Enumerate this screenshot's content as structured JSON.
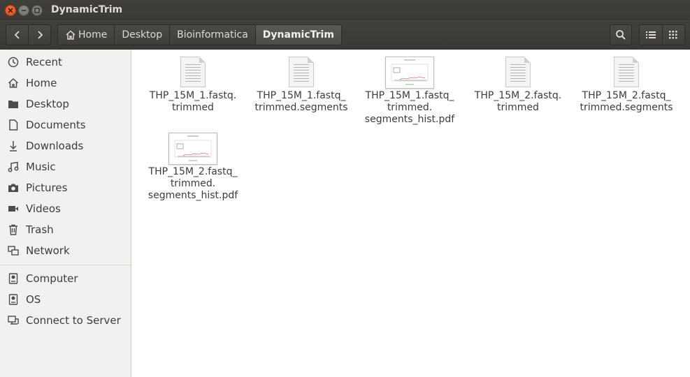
{
  "window": {
    "title": "DynamicTrim"
  },
  "breadcrumb": [
    {
      "label": "Home",
      "icon": "home-icon"
    },
    {
      "label": "Desktop"
    },
    {
      "label": "Bioinformatica"
    },
    {
      "label": "DynamicTrim",
      "active": true
    }
  ],
  "sidebar": {
    "items": [
      {
        "label": "Recent",
        "icon": "clock-icon"
      },
      {
        "label": "Home",
        "icon": "home-icon"
      },
      {
        "label": "Desktop",
        "icon": "folder-icon"
      },
      {
        "label": "Documents",
        "icon": "document-icon"
      },
      {
        "label": "Downloads",
        "icon": "download-icon"
      },
      {
        "label": "Music",
        "icon": "music-icon"
      },
      {
        "label": "Pictures",
        "icon": "camera-icon"
      },
      {
        "label": "Videos",
        "icon": "video-icon"
      },
      {
        "label": "Trash",
        "icon": "trash-icon"
      },
      {
        "label": "Network",
        "icon": "network-icon"
      }
    ],
    "devices": [
      {
        "label": "Computer",
        "icon": "drive-icon"
      },
      {
        "label": "OS",
        "icon": "drive-icon"
      },
      {
        "label": "Connect to Server",
        "icon": "server-icon"
      }
    ]
  },
  "files": [
    {
      "lines": [
        "THP_15M_1.fastq.",
        "trimmed"
      ],
      "icon": "text-file-icon"
    },
    {
      "lines": [
        "THP_15M_1.fastq_",
        "trimmed.segments"
      ],
      "icon": "text-file-icon"
    },
    {
      "lines": [
        "THP_15M_1.fastq_",
        "trimmed.",
        "segments_hist.pdf"
      ],
      "icon": "pdf-thumbnail-icon"
    },
    {
      "lines": [
        "THP_15M_2.fastq.",
        "trimmed"
      ],
      "icon": "text-file-icon"
    },
    {
      "lines": [
        "THP_15M_2.fastq_",
        "trimmed.segments"
      ],
      "icon": "text-file-icon"
    },
    {
      "lines": [
        "THP_15M_2.fastq_",
        "trimmed.",
        "segments_hist.pdf"
      ],
      "icon": "pdf-thumbnail-icon"
    }
  ],
  "colors": {
    "titlebar": "#3c3b37",
    "close": "#e95420",
    "sidebar": "#f2f1f0"
  }
}
